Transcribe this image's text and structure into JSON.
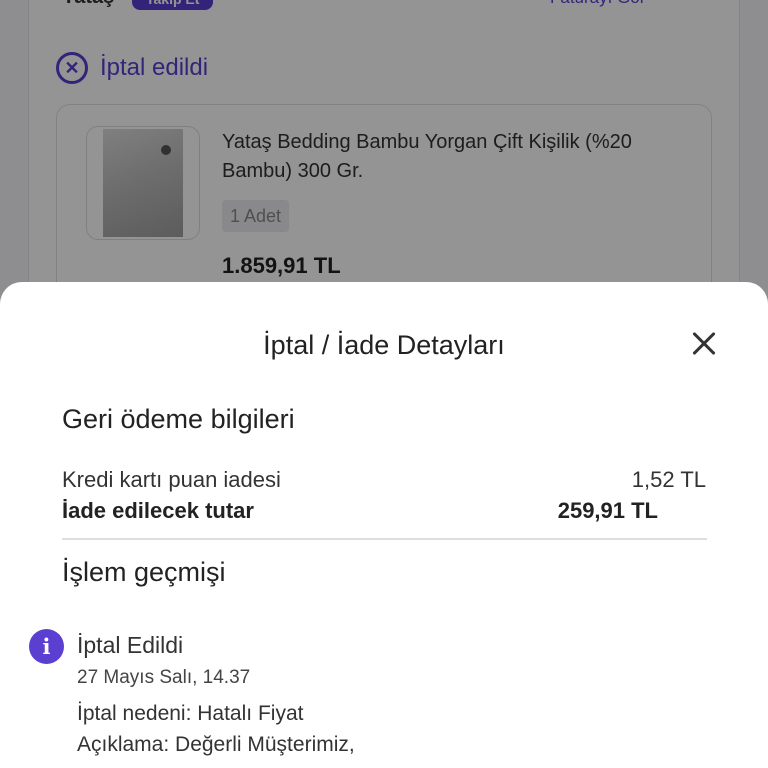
{
  "background": {
    "brand": "Yataş",
    "badge": "Takip Et",
    "invoice_link": "Faturayı Gör",
    "status": "İptal edildi",
    "product": {
      "title": "Yataş Bedding  Bambu Yorgan Çift Kişilik (%20 Bambu) 300 Gr.",
      "quantity": "1 Adet",
      "price": "1.859,91 TL"
    }
  },
  "sheet": {
    "title": "İptal / İade Detayları",
    "refund_section": {
      "heading": "Geri ödeme bilgileri",
      "rows": [
        {
          "label": "Kredi kartı puan iadesi",
          "value": "1,52 TL"
        },
        {
          "label": "İade edilecek tutar",
          "value": "259,91 TL"
        }
      ]
    },
    "history_section": {
      "heading": "İşlem geçmişi",
      "events": [
        {
          "icon": "info-icon",
          "title": "İptal Edildi",
          "date": "27 Mayıs Salı, 14.37",
          "reason": "İptal nedeni: Hatalı Fiyat",
          "description": "Açıklama: Değerli Müşterimiz,"
        }
      ]
    }
  },
  "colors": {
    "accent": "#5b3fd1",
    "overlay": "rgba(0,0,0,0.42)",
    "sheet_background": "#ffffff"
  }
}
